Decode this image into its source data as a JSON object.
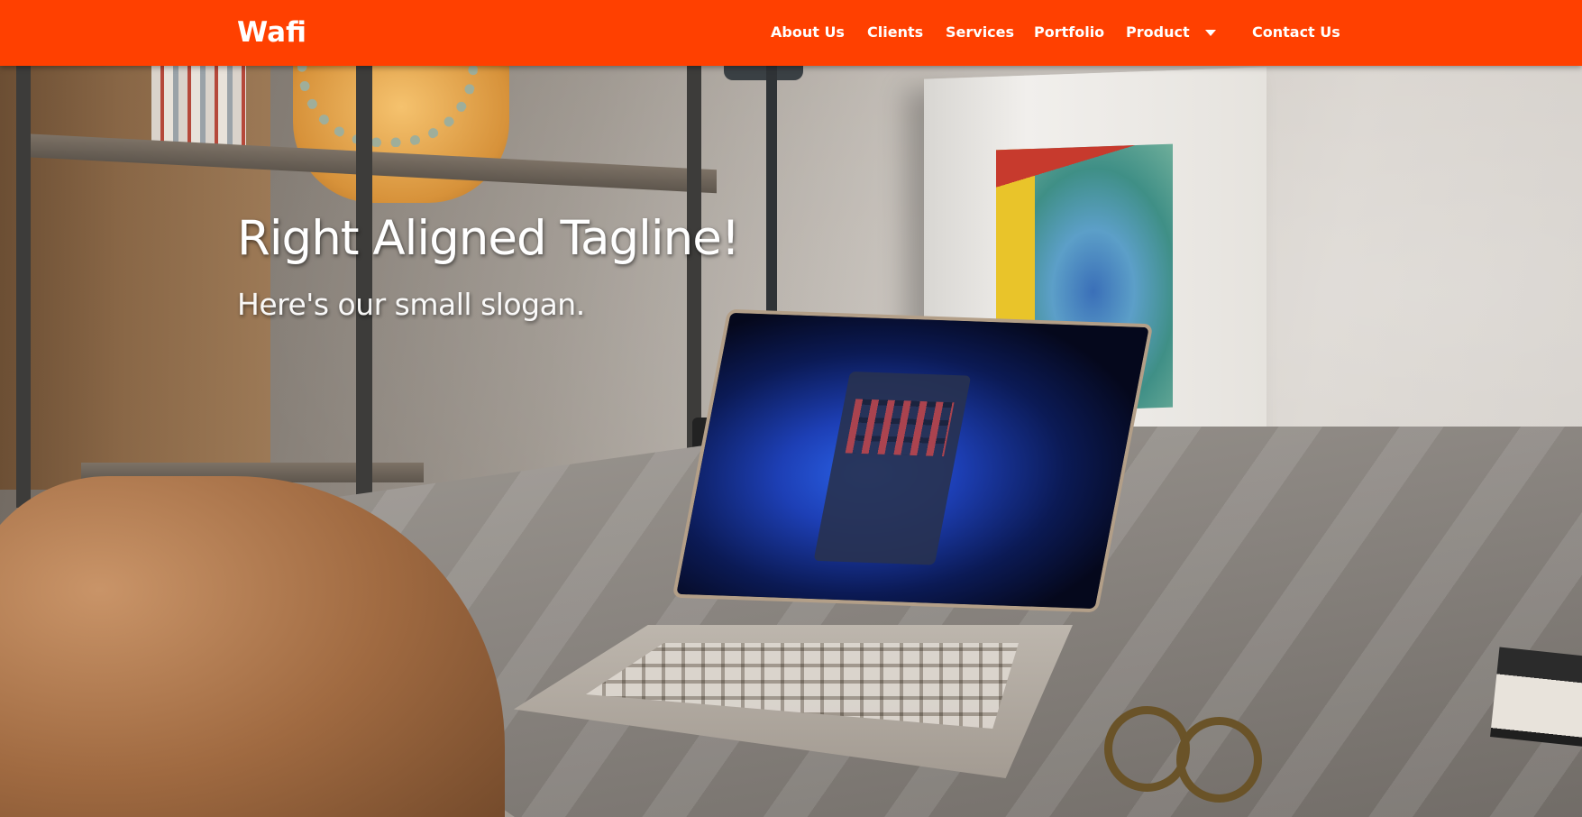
{
  "brand": {
    "name": "Wafi",
    "color": "#ff4000"
  },
  "nav": {
    "items": [
      {
        "label": "About Us"
      },
      {
        "label": "Clients"
      },
      {
        "label": "Services"
      },
      {
        "label": "Portfolio"
      },
      {
        "label": "Product",
        "has_dropdown": true,
        "icon": "caret-down-icon"
      },
      {
        "label": "Contact Us"
      }
    ]
  },
  "hero": {
    "tagline": "Right Aligned Tagline!",
    "slogan": "Here's our small slogan."
  }
}
